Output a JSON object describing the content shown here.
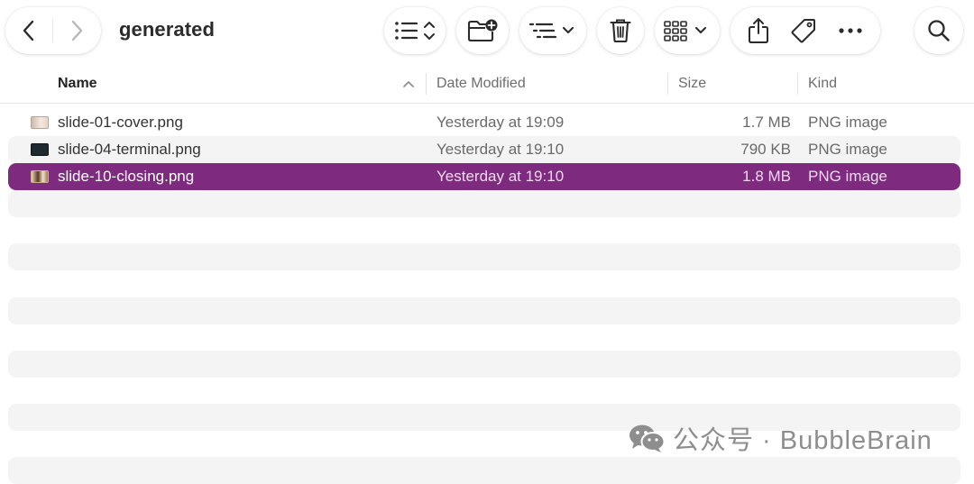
{
  "window": {
    "folder_title": "generated"
  },
  "toolbar": {
    "back_icon": "chevron-left-icon",
    "forward_icon": "chevron-right-icon",
    "view_icon": "list-view-icon",
    "new_folder_icon": "folder-plus-icon",
    "group_icon": "group-by-icon",
    "trash_icon": "trash-icon",
    "gallery_icon": "icon-grid-icon",
    "share_icon": "share-icon",
    "tag_icon": "tag-icon",
    "more_icon": "ellipsis-icon",
    "search_icon": "search-icon"
  },
  "columns": {
    "name": "Name",
    "date": "Date Modified",
    "size": "Size",
    "kind": "Kind",
    "sort": "ascending"
  },
  "files": [
    {
      "name": "slide-01-cover.png",
      "date": "Yesterday at 19:09",
      "size": "1.7 MB",
      "kind": "PNG image"
    },
    {
      "name": "slide-04-terminal.png",
      "date": "Yesterday at 19:10",
      "size": "790 KB",
      "kind": "PNG image"
    },
    {
      "name": "slide-10-closing.png",
      "date": "Yesterday at 19:10",
      "size": "1.8 MB",
      "kind": "PNG image"
    }
  ],
  "selected_file": "slide-10-closing.png",
  "colors": {
    "selection": "#7d2a7f",
    "alt_row": "#f4f4f4"
  },
  "watermark": {
    "icon": "wechat-icon",
    "text": "公众号 · BubbleBrain"
  }
}
